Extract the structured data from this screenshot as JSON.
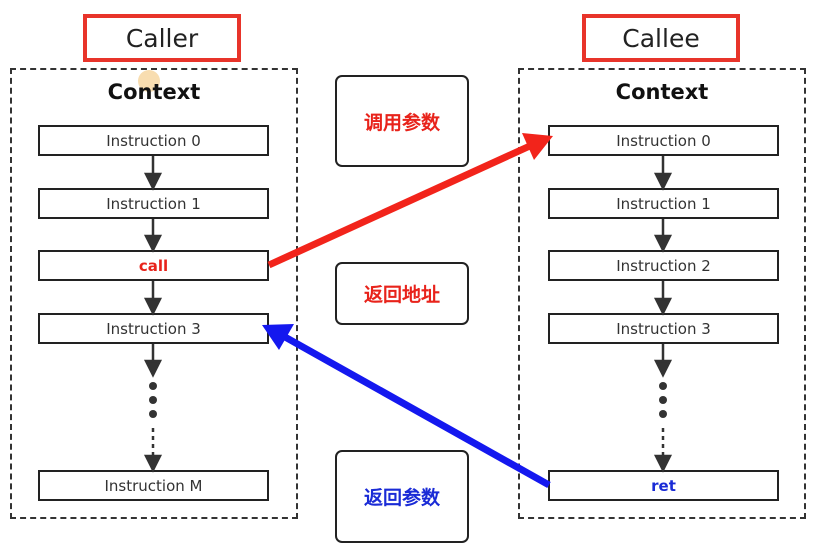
{
  "caller": {
    "title": "Caller",
    "context": "Context",
    "instructions": [
      "Instruction 0",
      "Instruction 1",
      "call",
      "Instruction 3",
      "Instruction M"
    ]
  },
  "callee": {
    "title": "Callee",
    "context": "Context",
    "instructions": [
      "Instruction 0",
      "Instruction 1",
      "Instruction 2",
      "Instruction 3",
      "ret"
    ]
  },
  "middle": {
    "call_params": "调用参数",
    "return_address": "返回地址",
    "return_params": "返回参数"
  },
  "colors": {
    "accent_red": "#e8231b",
    "accent_blue": "#1a2bd6",
    "title_border": "#e8342a"
  }
}
